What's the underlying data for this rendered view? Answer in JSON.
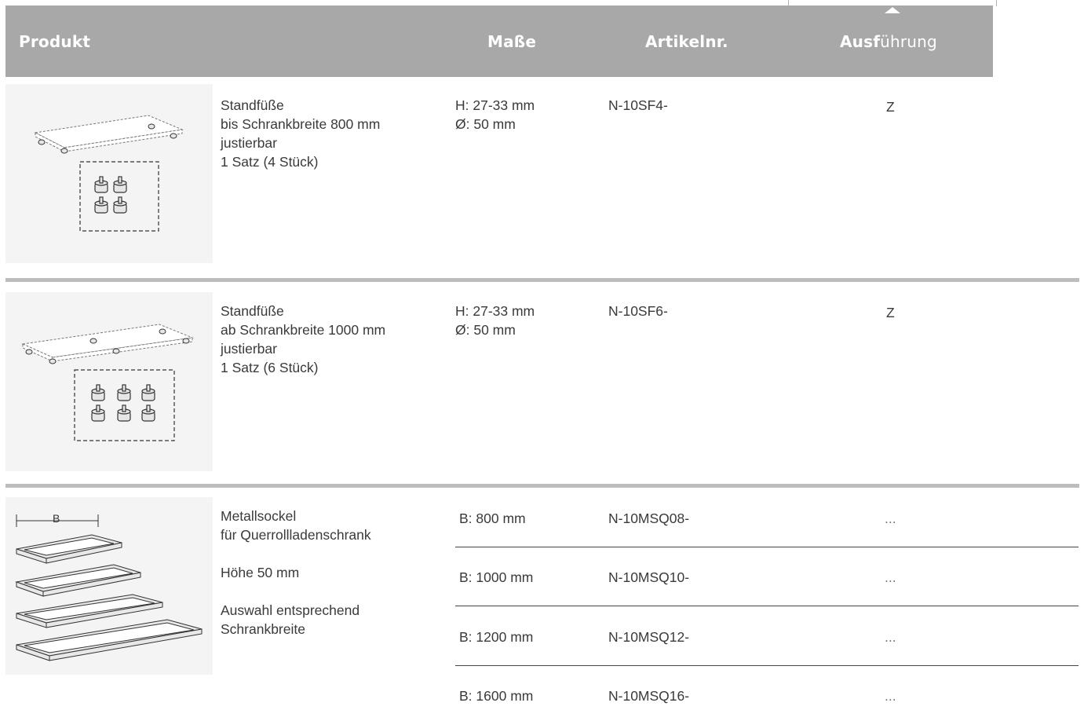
{
  "header": {
    "product": "Produkt",
    "dimensions": "Maße",
    "article_no": "Artikelnr.",
    "finish_bold": "Ausf",
    "finish_rest": "ührung"
  },
  "rows": [
    {
      "desc": [
        "Standfüße",
        "bis Schrankbreite 800 mm",
        "justierbar",
        "1 Satz (4 Stück)"
      ],
      "dims": [
        "H: 27-33 mm",
        "Ø: 50 mm"
      ],
      "article": "N-10SF4-",
      "finish": "Z"
    },
    {
      "desc": [
        "Standfüße",
        "ab Schrankbreite 1000 mm",
        "justierbar",
        "1 Satz (6 Stück)"
      ],
      "dims": [
        "H: 27-33 mm",
        "Ø: 50 mm"
      ],
      "article": "N-10SF6-",
      "finish": "Z"
    },
    {
      "desc": [
        "Metallsockel",
        "für Querrollladenschrank",
        "Höhe 50 mm",
        "Auswahl entsprechend",
        "Schrankbreite"
      ],
      "image_label": "B",
      "variants": [
        {
          "dim": "B: 800 mm",
          "article": "N-10MSQ08-",
          "finish": "..."
        },
        {
          "dim": "B: 1000 mm",
          "article": "N-10MSQ10-",
          "finish": "..."
        },
        {
          "dim": "B: 1200 mm",
          "article": "N-10MSQ12-",
          "finish": "..."
        },
        {
          "dim": "B: 1600 mm",
          "article": "N-10MSQ16-",
          "finish": "..."
        }
      ]
    }
  ]
}
